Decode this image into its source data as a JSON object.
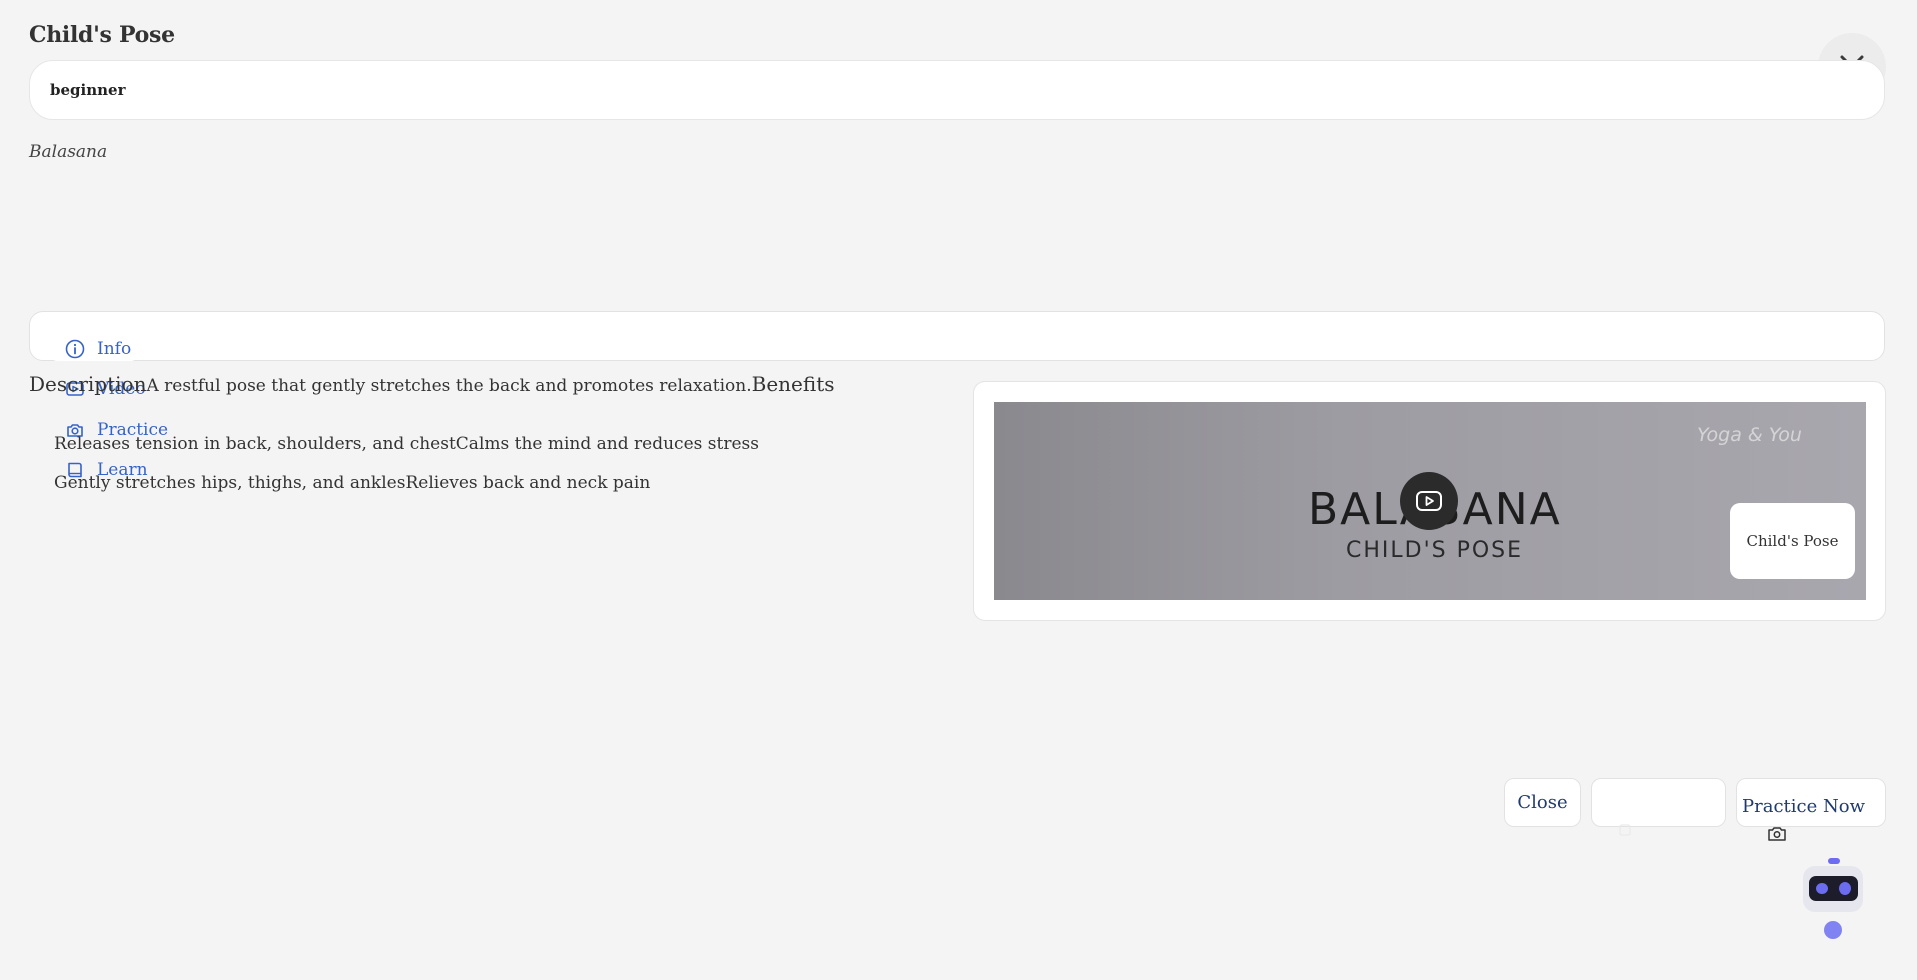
{
  "header": {
    "title": "Child's Pose"
  },
  "level": {
    "value": "beginner"
  },
  "pose": {
    "sanskrit_name": "Balasana"
  },
  "tabs": [
    {
      "label": "Info",
      "icon": "info-icon"
    },
    {
      "label": "Video",
      "icon": "video-icon"
    },
    {
      "label": "Practice",
      "icon": "camera-icon"
    },
    {
      "label": "Learn",
      "icon": "book-icon"
    }
  ],
  "content": {
    "description_heading": "Description",
    "description_text": "A restful pose that gently stretches the back and promotes relaxation.",
    "benefits_heading": "Benefits",
    "benefits": [
      "Releases tension in back, shoulders, and chest",
      "Calms the mind and reduces stress",
      "Gently stretches hips, thighs, and ankles",
      "Relieves back and neck pain"
    ]
  },
  "video": {
    "watermark": "Yoga & You",
    "title_text": "BALASANA",
    "subtitle_text": "CHILD'S POSE",
    "caption": "Child's Pose"
  },
  "footer": {
    "close_label": "Close",
    "practice_label": "Practice Now"
  },
  "colors": {
    "accent": "#3563c9",
    "background": "#f4f4f4",
    "assistant": "#6b6cf0"
  }
}
